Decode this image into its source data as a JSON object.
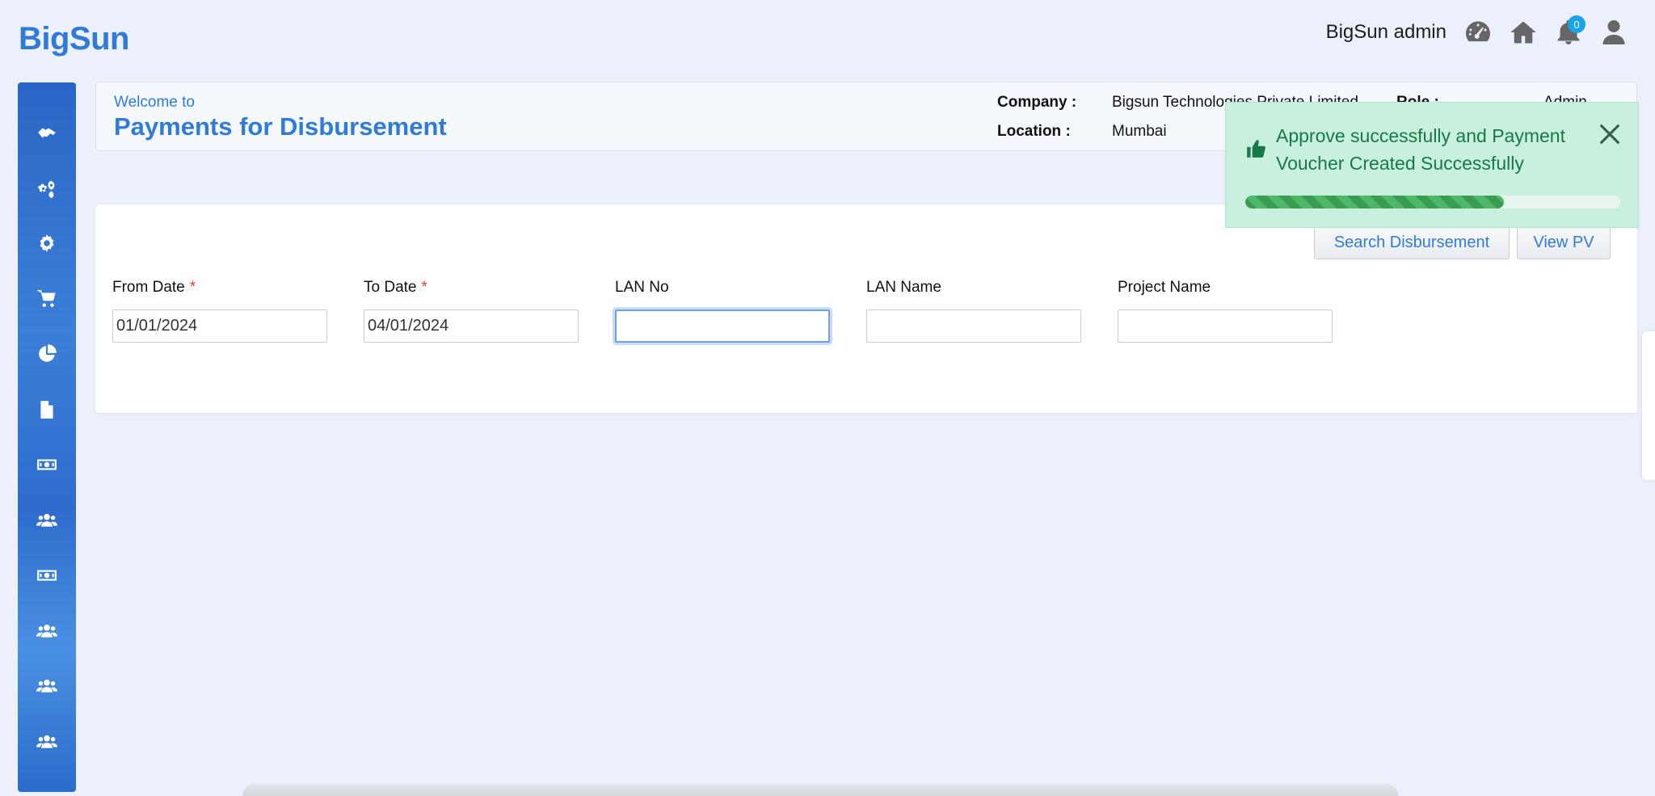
{
  "app": {
    "logo": "BigSun"
  },
  "topbar": {
    "username": "BigSun admin",
    "icons": [
      "speedometer-icon",
      "home-icon",
      "bell-icon",
      "user-icon"
    ],
    "notification_count": "0"
  },
  "sidebar": {
    "items": [
      {
        "icon": "handshake-icon"
      },
      {
        "icon": "gears-icon"
      },
      {
        "icon": "gear-icon"
      },
      {
        "icon": "cart-icon"
      },
      {
        "icon": "pie-chart-icon"
      },
      {
        "icon": "document-icon"
      },
      {
        "icon": "money-icon"
      },
      {
        "icon": "users-icon"
      },
      {
        "icon": "money-icon"
      },
      {
        "icon": "users-icon"
      },
      {
        "icon": "users-icon"
      },
      {
        "icon": "users-icon"
      }
    ]
  },
  "header": {
    "welcome": "Welcome to",
    "title": "Payments for Disbursement",
    "company_label": "Company :",
    "company_value": "Bigsun Technologies Private Limited",
    "location_label": "Location :",
    "location_value": "Mumbai",
    "role_label": "Role :",
    "role_value": "Admin"
  },
  "filters": {
    "search_button": "Search Disbursement",
    "view_pv_button": "View PV",
    "fields": [
      {
        "label": "From Date",
        "required": true,
        "value": "01/01/2024"
      },
      {
        "label": "To Date",
        "required": true,
        "value": "04/01/2024"
      },
      {
        "label": "LAN No",
        "required": false,
        "value": ""
      },
      {
        "label": "LAN Name",
        "required": false,
        "value": ""
      },
      {
        "label": "Project Name",
        "required": false,
        "value": ""
      }
    ],
    "required_mark": "*"
  },
  "toast": {
    "message": "Approve successfully and Payment Voucher Created Successfully",
    "progress_percent": 69,
    "colors": {
      "background": "#c9f0dc",
      "text": "#157a46",
      "progress": "#3a9c53"
    }
  },
  "colors": {
    "accent": "#2f7bd6",
    "background": "#ebf0fa"
  }
}
